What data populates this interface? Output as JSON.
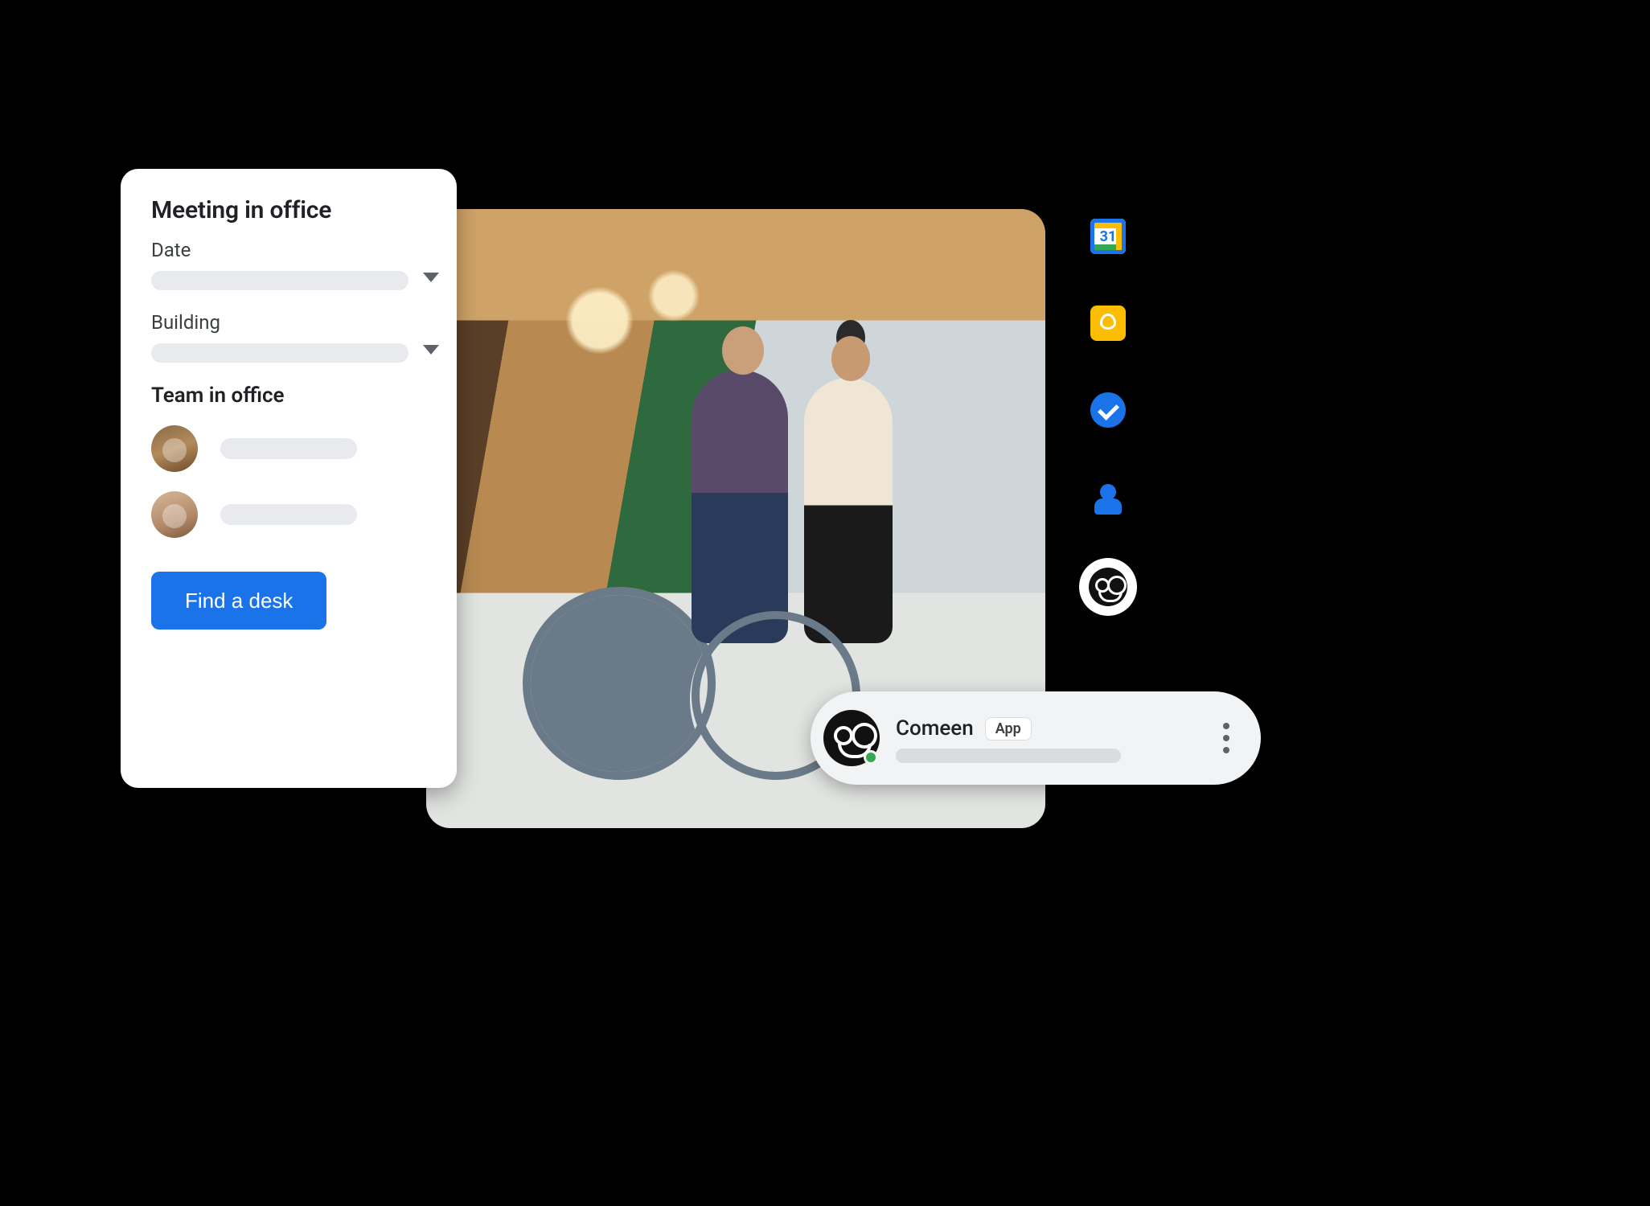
{
  "meeting_card": {
    "title": "Meeting in office",
    "date_label": "Date",
    "building_label": "Building",
    "team_section_title": "Team in office",
    "find_button_label": "Find a desk"
  },
  "side_rail": {
    "calendar_day": "31",
    "icons": [
      "calendar-icon",
      "keep-icon",
      "tasks-icon",
      "contacts-icon",
      "comeen-app-icon"
    ]
  },
  "chat_bubble": {
    "app_name": "Comeen",
    "badge_label": "App"
  }
}
